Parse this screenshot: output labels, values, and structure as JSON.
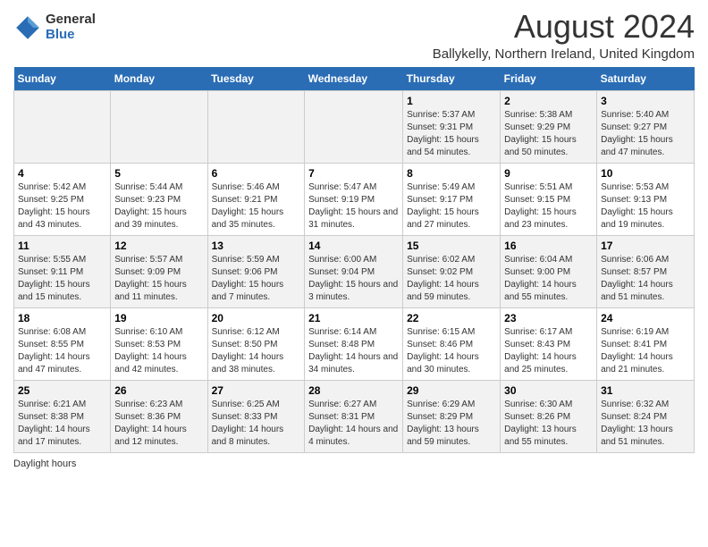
{
  "logo": {
    "general": "General",
    "blue": "Blue"
  },
  "title": "August 2024",
  "subtitle": "Ballykelly, Northern Ireland, United Kingdom",
  "days_of_week": [
    "Sunday",
    "Monday",
    "Tuesday",
    "Wednesday",
    "Thursday",
    "Friday",
    "Saturday"
  ],
  "footer": "Daylight hours",
  "weeks": [
    [
      {
        "day": "",
        "sunrise": "",
        "sunset": "",
        "daylight": ""
      },
      {
        "day": "",
        "sunrise": "",
        "sunset": "",
        "daylight": ""
      },
      {
        "day": "",
        "sunrise": "",
        "sunset": "",
        "daylight": ""
      },
      {
        "day": "",
        "sunrise": "",
        "sunset": "",
        "daylight": ""
      },
      {
        "day": "1",
        "sunrise": "5:37 AM",
        "sunset": "9:31 PM",
        "daylight": "15 hours and 54 minutes."
      },
      {
        "day": "2",
        "sunrise": "5:38 AM",
        "sunset": "9:29 PM",
        "daylight": "15 hours and 50 minutes."
      },
      {
        "day": "3",
        "sunrise": "5:40 AM",
        "sunset": "9:27 PM",
        "daylight": "15 hours and 47 minutes."
      }
    ],
    [
      {
        "day": "4",
        "sunrise": "5:42 AM",
        "sunset": "9:25 PM",
        "daylight": "15 hours and 43 minutes."
      },
      {
        "day": "5",
        "sunrise": "5:44 AM",
        "sunset": "9:23 PM",
        "daylight": "15 hours and 39 minutes."
      },
      {
        "day": "6",
        "sunrise": "5:46 AM",
        "sunset": "9:21 PM",
        "daylight": "15 hours and 35 minutes."
      },
      {
        "day": "7",
        "sunrise": "5:47 AM",
        "sunset": "9:19 PM",
        "daylight": "15 hours and 31 minutes."
      },
      {
        "day": "8",
        "sunrise": "5:49 AM",
        "sunset": "9:17 PM",
        "daylight": "15 hours and 27 minutes."
      },
      {
        "day": "9",
        "sunrise": "5:51 AM",
        "sunset": "9:15 PM",
        "daylight": "15 hours and 23 minutes."
      },
      {
        "day": "10",
        "sunrise": "5:53 AM",
        "sunset": "9:13 PM",
        "daylight": "15 hours and 19 minutes."
      }
    ],
    [
      {
        "day": "11",
        "sunrise": "5:55 AM",
        "sunset": "9:11 PM",
        "daylight": "15 hours and 15 minutes."
      },
      {
        "day": "12",
        "sunrise": "5:57 AM",
        "sunset": "9:09 PM",
        "daylight": "15 hours and 11 minutes."
      },
      {
        "day": "13",
        "sunrise": "5:59 AM",
        "sunset": "9:06 PM",
        "daylight": "15 hours and 7 minutes."
      },
      {
        "day": "14",
        "sunrise": "6:00 AM",
        "sunset": "9:04 PM",
        "daylight": "15 hours and 3 minutes."
      },
      {
        "day": "15",
        "sunrise": "6:02 AM",
        "sunset": "9:02 PM",
        "daylight": "14 hours and 59 minutes."
      },
      {
        "day": "16",
        "sunrise": "6:04 AM",
        "sunset": "9:00 PM",
        "daylight": "14 hours and 55 minutes."
      },
      {
        "day": "17",
        "sunrise": "6:06 AM",
        "sunset": "8:57 PM",
        "daylight": "14 hours and 51 minutes."
      }
    ],
    [
      {
        "day": "18",
        "sunrise": "6:08 AM",
        "sunset": "8:55 PM",
        "daylight": "14 hours and 47 minutes."
      },
      {
        "day": "19",
        "sunrise": "6:10 AM",
        "sunset": "8:53 PM",
        "daylight": "14 hours and 42 minutes."
      },
      {
        "day": "20",
        "sunrise": "6:12 AM",
        "sunset": "8:50 PM",
        "daylight": "14 hours and 38 minutes."
      },
      {
        "day": "21",
        "sunrise": "6:14 AM",
        "sunset": "8:48 PM",
        "daylight": "14 hours and 34 minutes."
      },
      {
        "day": "22",
        "sunrise": "6:15 AM",
        "sunset": "8:46 PM",
        "daylight": "14 hours and 30 minutes."
      },
      {
        "day": "23",
        "sunrise": "6:17 AM",
        "sunset": "8:43 PM",
        "daylight": "14 hours and 25 minutes."
      },
      {
        "day": "24",
        "sunrise": "6:19 AM",
        "sunset": "8:41 PM",
        "daylight": "14 hours and 21 minutes."
      }
    ],
    [
      {
        "day": "25",
        "sunrise": "6:21 AM",
        "sunset": "8:38 PM",
        "daylight": "14 hours and 17 minutes."
      },
      {
        "day": "26",
        "sunrise": "6:23 AM",
        "sunset": "8:36 PM",
        "daylight": "14 hours and 12 minutes."
      },
      {
        "day": "27",
        "sunrise": "6:25 AM",
        "sunset": "8:33 PM",
        "daylight": "14 hours and 8 minutes."
      },
      {
        "day": "28",
        "sunrise": "6:27 AM",
        "sunset": "8:31 PM",
        "daylight": "14 hours and 4 minutes."
      },
      {
        "day": "29",
        "sunrise": "6:29 AM",
        "sunset": "8:29 PM",
        "daylight": "13 hours and 59 minutes."
      },
      {
        "day": "30",
        "sunrise": "6:30 AM",
        "sunset": "8:26 PM",
        "daylight": "13 hours and 55 minutes."
      },
      {
        "day": "31",
        "sunrise": "6:32 AM",
        "sunset": "8:24 PM",
        "daylight": "13 hours and 51 minutes."
      }
    ]
  ]
}
